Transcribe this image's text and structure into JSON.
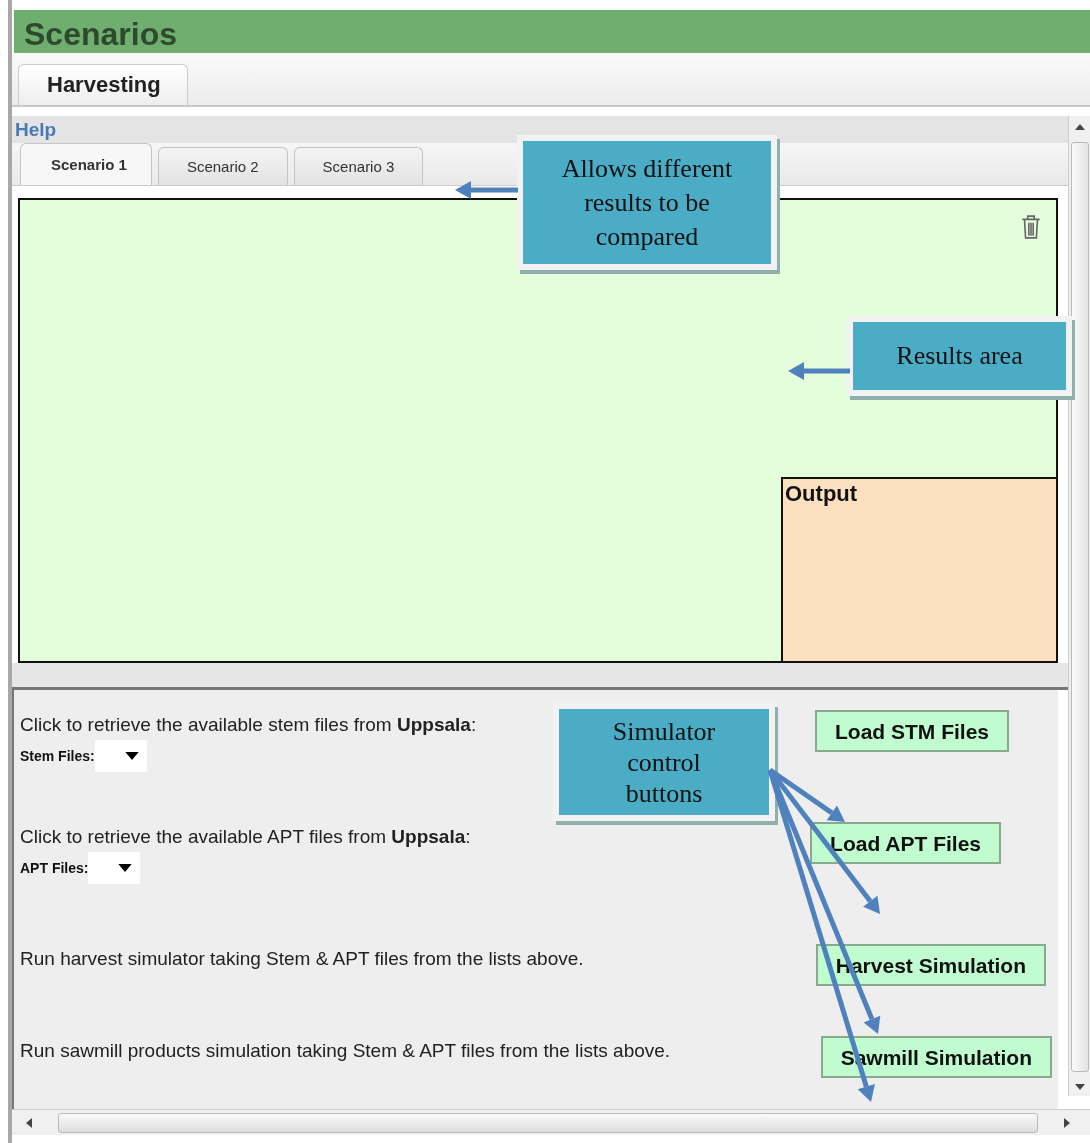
{
  "header": {
    "title": "Scenarios"
  },
  "main_tabs": [
    {
      "label": "Harvesting",
      "selected": true
    }
  ],
  "help_link": "Help",
  "scenario_tabs": [
    {
      "label": "Scenario 1",
      "selected": true
    },
    {
      "label": "Scenario 2",
      "selected": false
    },
    {
      "label": "Scenario 3",
      "selected": false
    }
  ],
  "results_panel": {
    "output_title": "Output"
  },
  "controls": [
    {
      "description": "Click to retrieve the available stem files from **Uppsala**:",
      "select_label": "Stem Files:",
      "button": "Load STM Files"
    },
    {
      "description": "Click to retrieve the available APT files from **Uppsala**:",
      "select_label": "APT Files:",
      "button": "Load APT Files"
    },
    {
      "description": "Run harvest simulator taking Stem & APT files from the lists above.",
      "button": "Harvest Simulation"
    },
    {
      "description": "Run sawmill products simulation taking Stem & APT files from the lists above.",
      "button": "Sawmill Simulation"
    }
  ],
  "callouts": [
    {
      "kind": "tabs",
      "text": "Allows different results to be compared"
    },
    {
      "kind": "results",
      "text": "Results area"
    },
    {
      "kind": "buttons",
      "text": "Simulator control buttons"
    }
  ]
}
